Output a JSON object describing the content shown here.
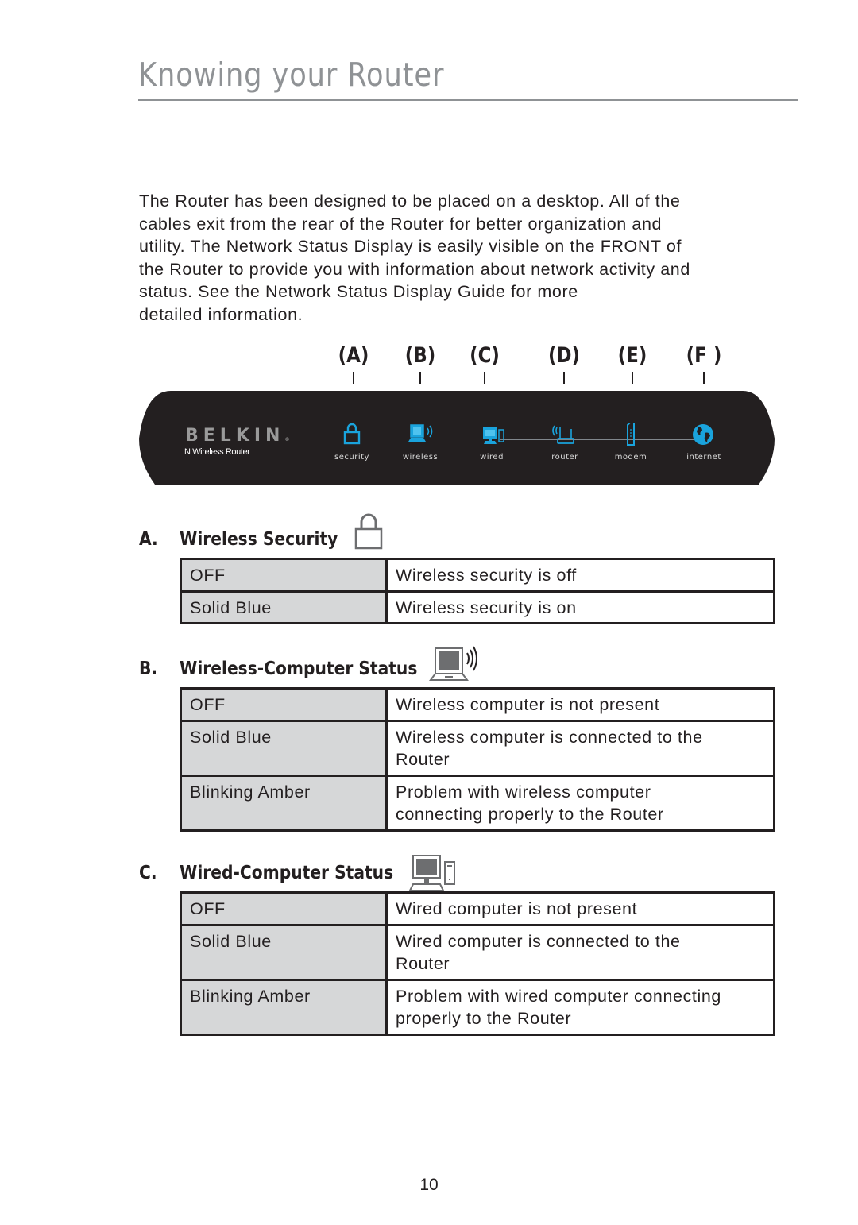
{
  "page": {
    "title": "Knowing your Router",
    "page_number": "10"
  },
  "intro": {
    "lines": [
      "The Router has been designed to be placed on a desktop. All of the",
      "cables exit from the rear of the Router for better organization and",
      "utility. The Network Status Display is easily visible on the FRONT of",
      "the Router to provide you with information about network activity and",
      "status. See the Network Status Display Guide for more",
      "detailed information."
    ]
  },
  "router_panel": {
    "brand": "BELKIN",
    "brand_mark": "®",
    "model": "N Wireless Router",
    "callouts": [
      "(A)",
      "(B)",
      "(C)",
      "(D)",
      "(E)",
      "(F )"
    ],
    "leds": [
      {
        "label": "security",
        "icon": "lock-icon"
      },
      {
        "label": "wireless",
        "icon": "wireless-laptop-icon"
      },
      {
        "label": "wired",
        "icon": "desktop-computer-icon"
      },
      {
        "label": "router",
        "icon": "router-icon"
      },
      {
        "label": "modem",
        "icon": "modem-icon"
      },
      {
        "label": "internet",
        "icon": "globe-icon"
      }
    ],
    "colors": {
      "panel": "#231f20",
      "led_blue": "#1aa3dc",
      "brand_gray": "#9a9a9a"
    }
  },
  "sections": [
    {
      "letter": "A.",
      "heading": "Wireless Security",
      "icon": "lock-icon",
      "rows": [
        {
          "state": "OFF",
          "desc": [
            "Wireless security is off"
          ]
        },
        {
          "state": "Solid Blue",
          "desc": [
            "Wireless security is on"
          ]
        }
      ]
    },
    {
      "letter": "B.",
      "heading": "Wireless-Computer Status",
      "icon": "wireless-laptop-icon",
      "rows": [
        {
          "state": "OFF",
          "desc": [
            "Wireless computer is not present"
          ]
        },
        {
          "state": "Solid Blue",
          "desc": [
            "Wireless computer is connected to the",
            "Router"
          ]
        },
        {
          "state": "Blinking Amber",
          "desc": [
            "Problem with wireless computer",
            "connecting properly to the Router"
          ]
        }
      ]
    },
    {
      "letter": "C.",
      "heading": "Wired-Computer Status",
      "icon": "desktop-computer-icon",
      "rows": [
        {
          "state": "OFF",
          "desc": [
            "Wired computer is not present"
          ]
        },
        {
          "state": "Solid Blue",
          "desc": [
            "Wired computer is connected to the",
            "Router"
          ]
        },
        {
          "state": "Blinking Amber",
          "desc": [
            "Problem with wired computer connecting",
            "properly to the Router"
          ]
        }
      ]
    }
  ]
}
